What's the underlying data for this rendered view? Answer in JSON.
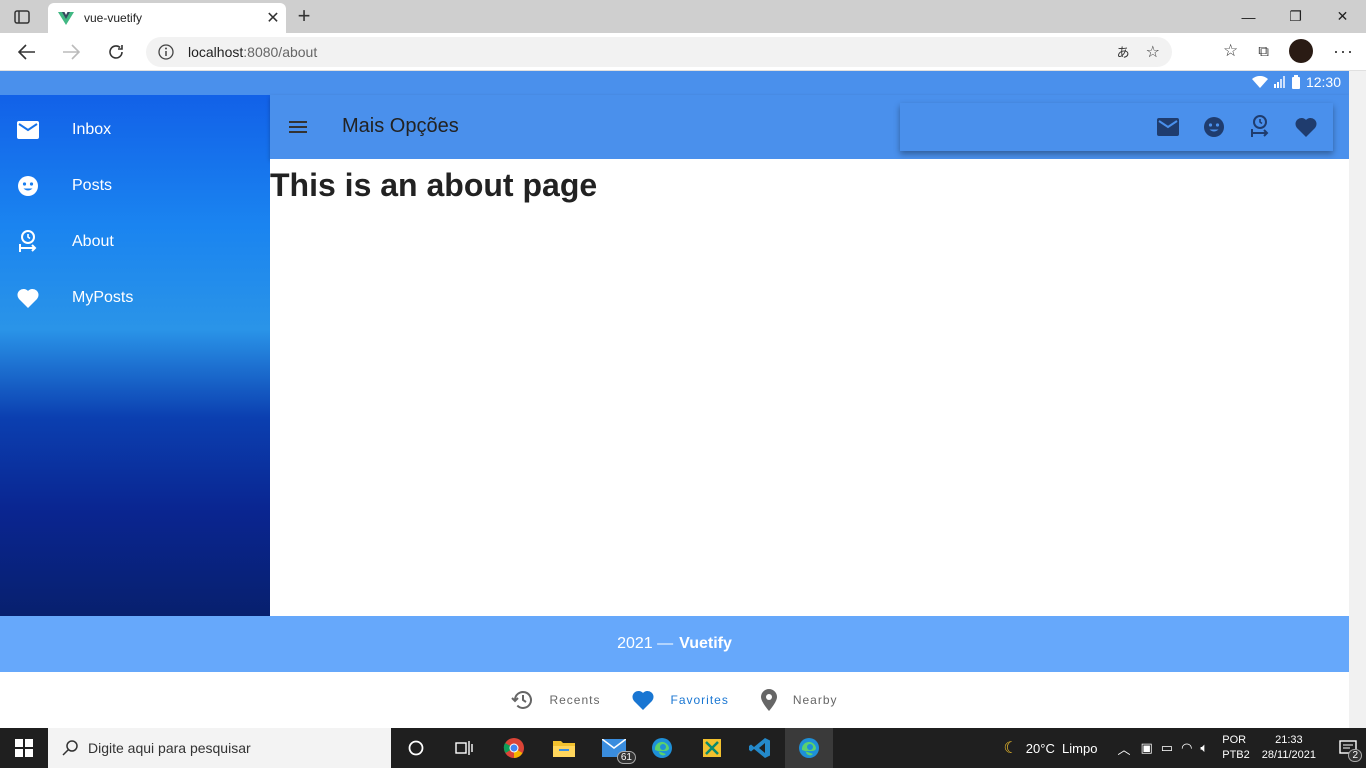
{
  "browser": {
    "tab_title": "vue-vuetify",
    "url_host": "localhost",
    "url_path": ":8080/about"
  },
  "status": {
    "time": "12:30"
  },
  "drawer": {
    "items": [
      {
        "label": "Inbox",
        "icon": "mail-icon"
      },
      {
        "label": "Posts",
        "icon": "emoticon-icon"
      },
      {
        "label": "About",
        "icon": "account-clock-icon"
      },
      {
        "label": "MyPosts",
        "icon": "heart-icon"
      }
    ]
  },
  "toolbar": {
    "title": "Mais Opções"
  },
  "content": {
    "heading": "This is an about page"
  },
  "footer": {
    "year": "2021 —",
    "brand": "Vuetify"
  },
  "bottom_nav": {
    "items": [
      {
        "label": "Recents",
        "icon": "history-icon",
        "active": false
      },
      {
        "label": "Favorites",
        "icon": "heart-icon",
        "active": true
      },
      {
        "label": "Nearby",
        "icon": "map-marker-icon",
        "active": false
      }
    ]
  },
  "taskbar": {
    "search_placeholder": "Digite aqui para pesquisar",
    "mail_badge": "61",
    "weather": "20°C  Limpo",
    "lang": "POR",
    "layout": "PTB2",
    "time": "21:33",
    "date": "28/11/2021",
    "notif_count": "2"
  },
  "colors": {
    "primary": "#4a90ec",
    "footer": "#66a8fb",
    "active": "#1976d2"
  }
}
